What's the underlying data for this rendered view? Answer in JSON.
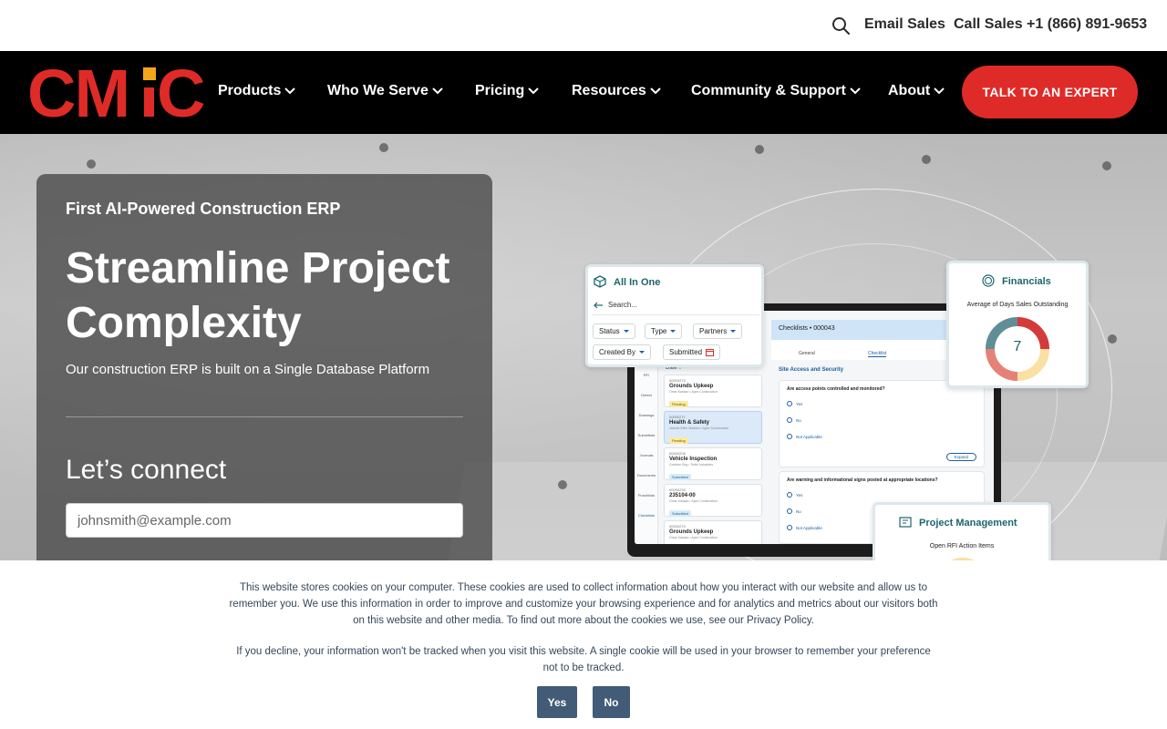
{
  "topbar": {
    "search_icon": "search-icon",
    "email_sales": "Email Sales",
    "call_sales": "Call Sales +1 (866) 891-9653"
  },
  "nav": {
    "logo_text": "CMiC",
    "items": [
      {
        "label": "Products"
      },
      {
        "label": "Who We Serve"
      },
      {
        "label": "Pricing"
      },
      {
        "label": "Resources"
      },
      {
        "label": "Community & Support"
      },
      {
        "label": "About"
      }
    ],
    "cta": "TALK TO AN EXPERT",
    "brand_red": "#df2b27",
    "bar_color": "#000000"
  },
  "hero": {
    "eyebrow": "First AI-Powered Construction ERP",
    "headline": "Streamline Project Complexity",
    "subhead": "Our construction ERP is built on a Single Database Platform",
    "connect_heading": "Let’s connect",
    "email_placeholder": "johnsmith@example.com"
  },
  "mockup": {
    "all_in_one": {
      "title": "All In One",
      "search_placeholder": "Search...",
      "filters": [
        "Status",
        "Type",
        "Partners",
        "Created By",
        "Submitted"
      ]
    },
    "financials": {
      "title": "Financials",
      "subtitle": "Average of Days Sales Outstanding",
      "value": "7"
    },
    "project_management": {
      "title": "Project Management",
      "subtitle": "Open RFI Action Items"
    },
    "laptop": {
      "header": "Checklists  •  000043",
      "tabs": [
        "General",
        "Checklist"
      ],
      "section": "Site Access and Security",
      "sort_label": "Date ↓",
      "sidebar": [
        "RFI",
        "Detect",
        "Drawings",
        "Submittals",
        "Journals",
        "Documents",
        "Punchlists",
        "Checklists"
      ],
      "list": [
        {
          "id": "00000270",
          "title": "Grounds Upkeep",
          "sub": "Omar Kassan • Apex Construction",
          "badge": "Pending"
        },
        {
          "id": "00000271",
          "title": "Health & Safety",
          "sub": "Joanne Ellen Madsen • Apex Construction",
          "badge": "Pending"
        },
        {
          "id": "00000206",
          "title": "Vehicle Inspection",
          "sub": "Graham Ong • Tridel Industries",
          "badge": "Submitted"
        },
        {
          "id": "00000233",
          "title": "235104-00",
          "sub": "Omar Kassan • Apex Construction",
          "badge": "Submitted"
        },
        {
          "id": "00000270",
          "title": "Grounds Upkeep",
          "sub": "Omar Kassan • Apex Construction",
          "badge": ""
        }
      ],
      "questions": [
        {
          "text": "Are access points controlled and monitored?",
          "options": [
            "Yes",
            "No",
            "Not Applicable"
          ],
          "button": "Expand"
        },
        {
          "text": "Are warning and informational signs posted at appropriate locations?",
          "options": [
            "Yes",
            "No",
            "Not Applicable"
          ]
        }
      ]
    }
  },
  "cookie": {
    "p1": "This website stores cookies on your computer. These cookies are used to collect information about how you interact with our website and allow us to remember you. We use this information in order to improve and customize your browsing experience and for analytics and metrics about our visitors both on this website and other media. To find out more about the cookies we use, see our Privacy Policy.",
    "p2": "If you decline, your information won't be tracked when you visit this website. A single cookie will be used in your browser to remember your preference not to be tracked.",
    "yes": "Yes",
    "no": "No",
    "button_color": "#425b76"
  }
}
